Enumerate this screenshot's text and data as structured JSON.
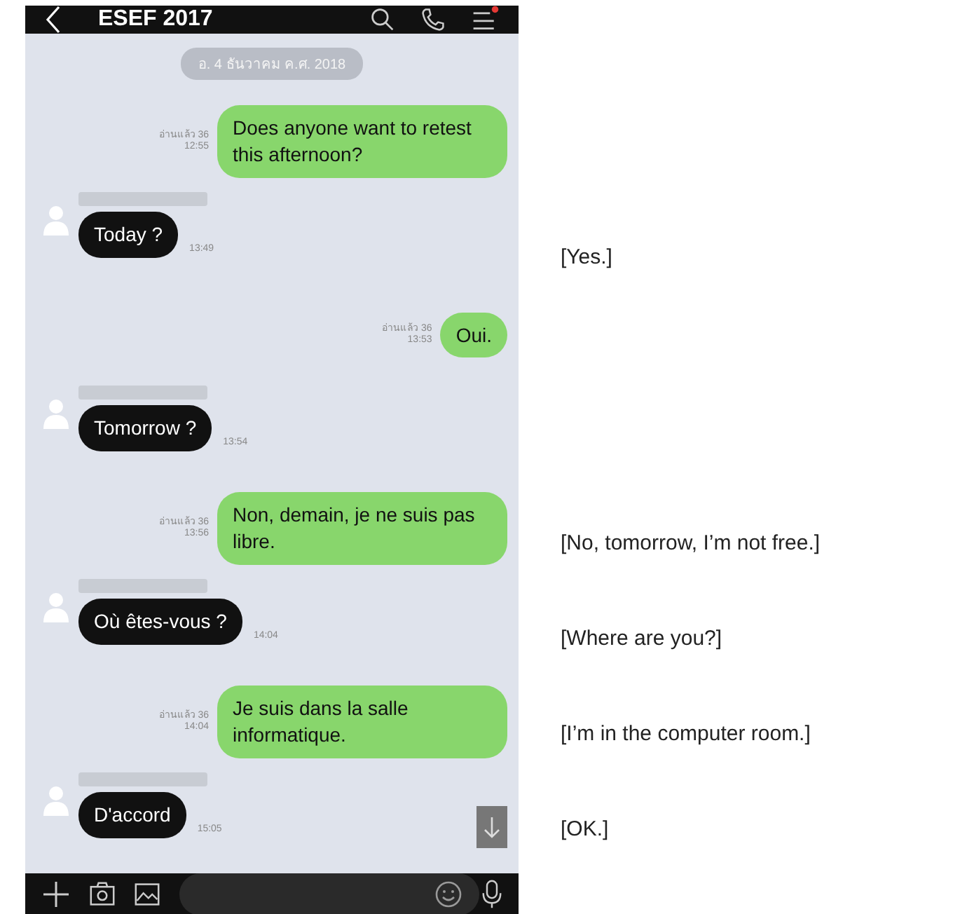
{
  "header": {
    "title": "ESEF 2017",
    "menu_badge": true
  },
  "date_label": "อ. 4 ธันวาคม ค.ศ. 2018",
  "messages": [
    {
      "kind": "sent",
      "text": "Does anyone want to retest this afternoon?",
      "receipt": "อ่านแล้ว 36",
      "time": "12:55"
    },
    {
      "kind": "received",
      "text": "Today ?",
      "time": "13:49",
      "translation": "[Yes.]"
    },
    {
      "kind": "sent",
      "text": "Oui.",
      "receipt": "อ่านแล้ว 36",
      "time": "13:53"
    },
    {
      "kind": "received",
      "text": "Tomorrow ?",
      "time": "13:54"
    },
    {
      "kind": "sent",
      "text": "Non, demain, je ne suis pas libre.",
      "receipt": "อ่านแล้ว 36",
      "time": "13:56",
      "translation": "[No, tomorrow, I’m not free.]"
    },
    {
      "kind": "received",
      "text": "Où êtes-vous ?",
      "time": "14:04",
      "translation": "[Where are you?]"
    },
    {
      "kind": "sent",
      "text": "Je suis dans la salle informatique.",
      "receipt": "อ่านแล้ว 36",
      "time": "14:04",
      "translation": "[I’m in the computer room.]"
    },
    {
      "kind": "received",
      "text": "D'accord",
      "time": "15:05",
      "translation": "[OK.]"
    }
  ]
}
